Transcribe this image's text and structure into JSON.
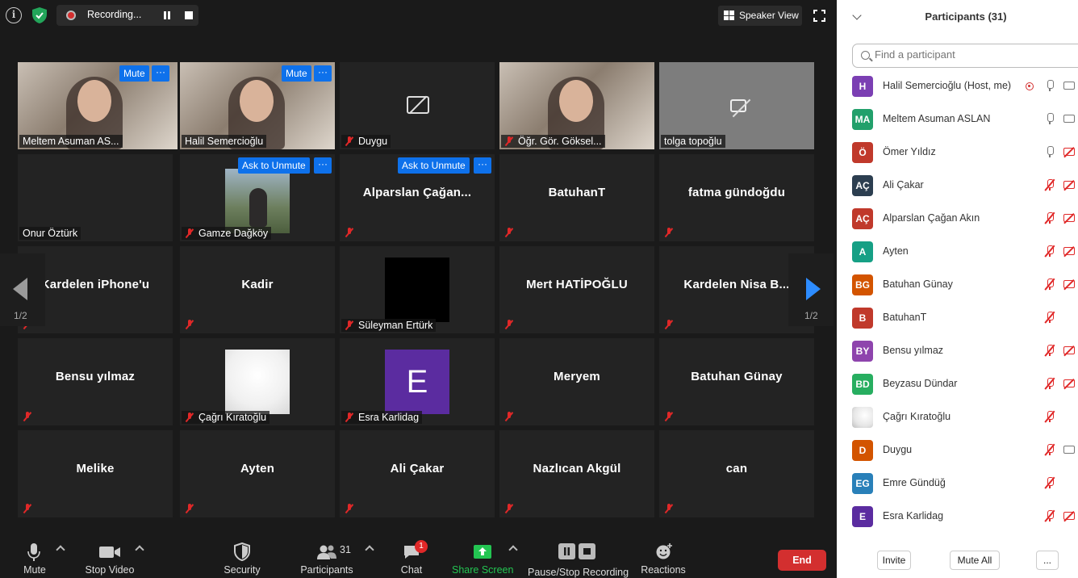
{
  "top_bar": {
    "recording_label": "Recording...",
    "speaker_view_label": "Speaker View"
  },
  "tiles": [
    {
      "name": "Meltem Asuman AS...",
      "label": "Meltem Asuman AS...",
      "type": "video",
      "active": true,
      "buttons": [
        "Mute",
        "···"
      ]
    },
    {
      "name": "Halil Semercioğlu",
      "label": "Halil Semercioğlu",
      "type": "video",
      "buttons": [
        "Mute",
        "···"
      ]
    },
    {
      "name": "Duygu",
      "label": "Duygu",
      "type": "camoff",
      "muted": true
    },
    {
      "name": "Öğr. Gör. Göksel...",
      "label": "Öğr. Gör. Göksel...",
      "type": "video",
      "muted": true
    },
    {
      "name": "tolga topoğlu",
      "label": "tolga topoğlu",
      "type": "camoff-grey"
    },
    {
      "name": "Onur Öztürk",
      "label": "Onur Öztürk",
      "type": "blank"
    },
    {
      "name": "Gamze Dağköy",
      "label": "Gamze Dağköy",
      "type": "photo",
      "muted": true,
      "buttons": [
        "Ask to Unmute",
        "···"
      ]
    },
    {
      "name": "Alparslan  Çağan...",
      "label": "",
      "type": "name",
      "muted": true,
      "buttons": [
        "Ask to Unmute",
        "···"
      ]
    },
    {
      "name": "BatuhanT",
      "label": "",
      "type": "name",
      "muted": true
    },
    {
      "name": "fatma gündoğdu",
      "label": "",
      "type": "name",
      "muted": true
    },
    {
      "name": "Kardelen iPhone'u",
      "label": "",
      "type": "name",
      "muted": true
    },
    {
      "name": "Kadir",
      "label": "",
      "type": "name",
      "muted": true
    },
    {
      "name": "Süleyman Ertürk",
      "label": "Süleyman Ertürk",
      "type": "blackbox",
      "muted": true
    },
    {
      "name": "Mert HATİPOĞLU",
      "label": "",
      "type": "name",
      "muted": true
    },
    {
      "name": "Kardelen Nisa B...",
      "label": "",
      "type": "name",
      "muted": true
    },
    {
      "name": "Bensu yılmaz",
      "label": "",
      "type": "name",
      "muted": true
    },
    {
      "name": "Çağrı Kıratoğlu",
      "label": "Çağrı Kıratoğlu",
      "type": "whitebox",
      "muted": true
    },
    {
      "name": "Esra Karlidag",
      "label": "Esra Karlidag",
      "type": "letter",
      "letter": "E",
      "muted": true
    },
    {
      "name": "Meryem",
      "label": "",
      "type": "name",
      "muted": true
    },
    {
      "name": "Batuhan Günay",
      "label": "",
      "type": "name",
      "muted": true
    },
    {
      "name": "Melike",
      "label": "",
      "type": "name",
      "muted": true
    },
    {
      "name": "Ayten",
      "label": "",
      "type": "name",
      "muted": true
    },
    {
      "name": "Ali Çakar",
      "label": "",
      "type": "name",
      "muted": true
    },
    {
      "name": "Nazlıcan Akgül",
      "label": "",
      "type": "name",
      "muted": true
    },
    {
      "name": "can",
      "label": "",
      "type": "name",
      "muted": true
    }
  ],
  "paging": {
    "left": "1/2",
    "right": "1/2"
  },
  "toolbar": {
    "mute": "Mute",
    "stop_video": "Stop Video",
    "security": "Security",
    "participants": "Participants",
    "participants_count": "31",
    "chat": "Chat",
    "chat_badge": "1",
    "share_screen": "Share Screen",
    "pause_stop_recording": "Pause/Stop Recording",
    "reactions": "Reactions",
    "end": "End"
  },
  "panel": {
    "title": "Participants (31)",
    "search_placeholder": "Find a participant",
    "invite": "Invite",
    "mute_all": "Mute All",
    "more": "...",
    "participants": [
      {
        "initials": "H",
        "name": "Halil Semercioğlu (Host, me)",
        "color": "#7b3fb3",
        "rec": true,
        "mic": "on",
        "cam": "on"
      },
      {
        "initials": "MA",
        "name": "Meltem Asuman ASLAN",
        "color": "#22a06b",
        "mic": "on",
        "cam": "on"
      },
      {
        "initials": "Ö",
        "name": "Ömer Yıldız",
        "color": "#c0392b",
        "mic": "on",
        "cam": "off"
      },
      {
        "initials": "AÇ",
        "name": "Ali Çakar",
        "color": "#2c3e50",
        "mic": "off",
        "cam": "off"
      },
      {
        "initials": "AÇ",
        "name": "Alparslan Çağan Akın",
        "color": "#c0392b",
        "mic": "off",
        "cam": "off"
      },
      {
        "initials": "A",
        "name": "Ayten",
        "color": "#16a085",
        "mic": "off",
        "cam": "off"
      },
      {
        "initials": "BG",
        "name": "Batuhan Günay",
        "color": "#d35400",
        "mic": "off",
        "cam": "off"
      },
      {
        "initials": "B",
        "name": "BatuhanT",
        "color": "#c0392b",
        "mic": "off",
        "cam": "none"
      },
      {
        "initials": "BY",
        "name": "Bensu yılmaz",
        "color": "#8e44ad",
        "mic": "off",
        "cam": "off"
      },
      {
        "initials": "BD",
        "name": "Beyzasu Dündar",
        "color": "#27ae60",
        "mic": "off",
        "cam": "off"
      },
      {
        "initials": "",
        "name": "Çağrı Kıratoğlu",
        "color": "#e8e8e8",
        "mic": "off",
        "cam": "none"
      },
      {
        "initials": "D",
        "name": "Duygu",
        "color": "#d35400",
        "mic": "off",
        "cam": "on"
      },
      {
        "initials": "EG",
        "name": "Emre Gündüğ",
        "color": "#2980b9",
        "mic": "off",
        "cam": "none"
      },
      {
        "initials": "E",
        "name": "Esra Karlidag",
        "color": "#5b2ca0",
        "mic": "off",
        "cam": "off"
      }
    ]
  }
}
